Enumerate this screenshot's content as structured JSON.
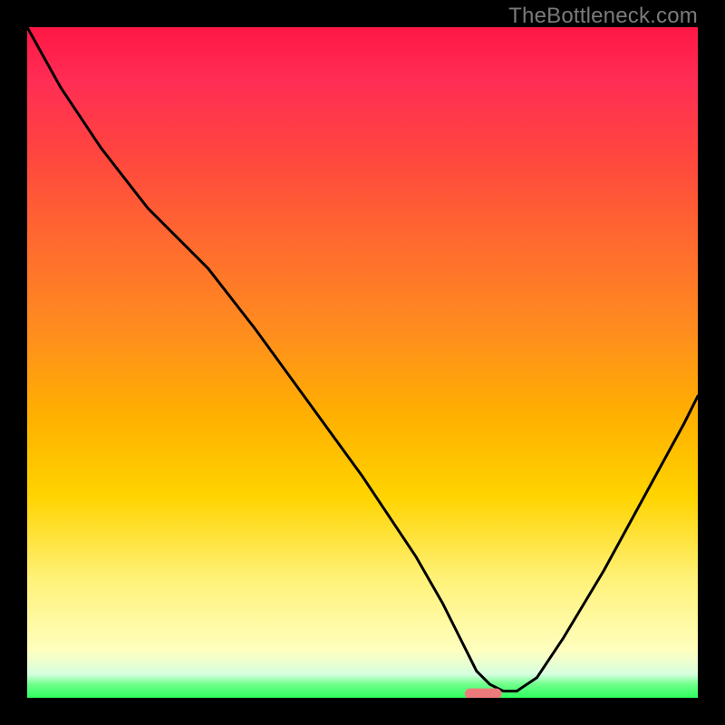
{
  "watermark": {
    "text": "TheBottleneck.com"
  },
  "colors": {
    "curve_stroke": "#000000",
    "marker_fill": "#ee7b7b",
    "frame": "#000000"
  },
  "chart_data": {
    "type": "line",
    "title": "",
    "xlabel": "",
    "ylabel": "",
    "xlim": [
      0,
      100
    ],
    "ylim": [
      0,
      100
    ],
    "grid": false,
    "legend": false,
    "series": [
      {
        "name": "bottleneck-curve",
        "x": [
          0,
          5,
          11,
          18,
          24,
          27,
          34,
          42,
          50,
          58,
          62,
          64,
          66,
          67,
          69,
          71,
          73,
          76,
          80,
          86,
          92,
          98,
          100
        ],
        "values": [
          100,
          91,
          82,
          73,
          67,
          64,
          55,
          44,
          33,
          21,
          14,
          10,
          6,
          4,
          2,
          1,
          1,
          3,
          9,
          19,
          30,
          41,
          45
        ]
      }
    ],
    "marker": {
      "name": "optimal-pill",
      "x_center": 68,
      "y": 0.6,
      "width": 5.5,
      "height": 1.6
    },
    "background_gradient_stops": [
      {
        "pos": 0.0,
        "hex": "#ff1744"
      },
      {
        "pos": 0.08,
        "hex": "#ff2d55"
      },
      {
        "pos": 0.18,
        "hex": "#ff4340"
      },
      {
        "pos": 0.32,
        "hex": "#ff6a2f"
      },
      {
        "pos": 0.45,
        "hex": "#ff8c1f"
      },
      {
        "pos": 0.58,
        "hex": "#ffb000"
      },
      {
        "pos": 0.7,
        "hex": "#ffd400"
      },
      {
        "pos": 0.82,
        "hex": "#fff176"
      },
      {
        "pos": 0.93,
        "hex": "#ffffbf"
      },
      {
        "pos": 0.965,
        "hex": "#d6ffe0"
      },
      {
        "pos": 0.98,
        "hex": "#6fff8a"
      },
      {
        "pos": 1.0,
        "hex": "#2eff5e"
      }
    ]
  }
}
